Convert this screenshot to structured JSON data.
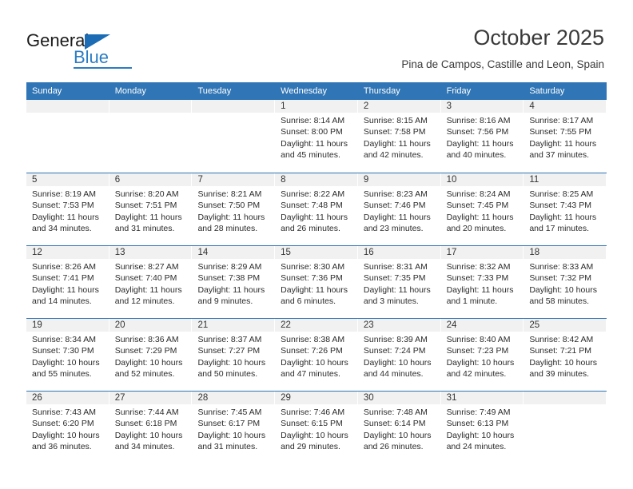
{
  "logo": {
    "word_top": "General",
    "word_bottom": "Blue",
    "accent_color": "#2b7cc4"
  },
  "header": {
    "month_title": "October 2025",
    "location": "Pina de Campos, Castille and Leon, Spain"
  },
  "calendar": {
    "header_bg": "#3075b5",
    "weekdays": [
      "Sunday",
      "Monday",
      "Tuesday",
      "Wednesday",
      "Thursday",
      "Friday",
      "Saturday"
    ],
    "weeks": [
      [
        {
          "day": "",
          "empty": true
        },
        {
          "day": "",
          "empty": true
        },
        {
          "day": "",
          "empty": true
        },
        {
          "day": "1",
          "sunrise": "Sunrise: 8:14 AM",
          "sunset": "Sunset: 8:00 PM",
          "daylight": "Daylight: 11 hours and 45 minutes."
        },
        {
          "day": "2",
          "sunrise": "Sunrise: 8:15 AM",
          "sunset": "Sunset: 7:58 PM",
          "daylight": "Daylight: 11 hours and 42 minutes."
        },
        {
          "day": "3",
          "sunrise": "Sunrise: 8:16 AM",
          "sunset": "Sunset: 7:56 PM",
          "daylight": "Daylight: 11 hours and 40 minutes."
        },
        {
          "day": "4",
          "sunrise": "Sunrise: 8:17 AM",
          "sunset": "Sunset: 7:55 PM",
          "daylight": "Daylight: 11 hours and 37 minutes."
        }
      ],
      [
        {
          "day": "5",
          "sunrise": "Sunrise: 8:19 AM",
          "sunset": "Sunset: 7:53 PM",
          "daylight": "Daylight: 11 hours and 34 minutes."
        },
        {
          "day": "6",
          "sunrise": "Sunrise: 8:20 AM",
          "sunset": "Sunset: 7:51 PM",
          "daylight": "Daylight: 11 hours and 31 minutes."
        },
        {
          "day": "7",
          "sunrise": "Sunrise: 8:21 AM",
          "sunset": "Sunset: 7:50 PM",
          "daylight": "Daylight: 11 hours and 28 minutes."
        },
        {
          "day": "8",
          "sunrise": "Sunrise: 8:22 AM",
          "sunset": "Sunset: 7:48 PM",
          "daylight": "Daylight: 11 hours and 26 minutes."
        },
        {
          "day": "9",
          "sunrise": "Sunrise: 8:23 AM",
          "sunset": "Sunset: 7:46 PM",
          "daylight": "Daylight: 11 hours and 23 minutes."
        },
        {
          "day": "10",
          "sunrise": "Sunrise: 8:24 AM",
          "sunset": "Sunset: 7:45 PM",
          "daylight": "Daylight: 11 hours and 20 minutes."
        },
        {
          "day": "11",
          "sunrise": "Sunrise: 8:25 AM",
          "sunset": "Sunset: 7:43 PM",
          "daylight": "Daylight: 11 hours and 17 minutes."
        }
      ],
      [
        {
          "day": "12",
          "sunrise": "Sunrise: 8:26 AM",
          "sunset": "Sunset: 7:41 PM",
          "daylight": "Daylight: 11 hours and 14 minutes."
        },
        {
          "day": "13",
          "sunrise": "Sunrise: 8:27 AM",
          "sunset": "Sunset: 7:40 PM",
          "daylight": "Daylight: 11 hours and 12 minutes."
        },
        {
          "day": "14",
          "sunrise": "Sunrise: 8:29 AM",
          "sunset": "Sunset: 7:38 PM",
          "daylight": "Daylight: 11 hours and 9 minutes."
        },
        {
          "day": "15",
          "sunrise": "Sunrise: 8:30 AM",
          "sunset": "Sunset: 7:36 PM",
          "daylight": "Daylight: 11 hours and 6 minutes."
        },
        {
          "day": "16",
          "sunrise": "Sunrise: 8:31 AM",
          "sunset": "Sunset: 7:35 PM",
          "daylight": "Daylight: 11 hours and 3 minutes."
        },
        {
          "day": "17",
          "sunrise": "Sunrise: 8:32 AM",
          "sunset": "Sunset: 7:33 PM",
          "daylight": "Daylight: 11 hours and 1 minute."
        },
        {
          "day": "18",
          "sunrise": "Sunrise: 8:33 AM",
          "sunset": "Sunset: 7:32 PM",
          "daylight": "Daylight: 10 hours and 58 minutes."
        }
      ],
      [
        {
          "day": "19",
          "sunrise": "Sunrise: 8:34 AM",
          "sunset": "Sunset: 7:30 PM",
          "daylight": "Daylight: 10 hours and 55 minutes."
        },
        {
          "day": "20",
          "sunrise": "Sunrise: 8:36 AM",
          "sunset": "Sunset: 7:29 PM",
          "daylight": "Daylight: 10 hours and 52 minutes."
        },
        {
          "day": "21",
          "sunrise": "Sunrise: 8:37 AM",
          "sunset": "Sunset: 7:27 PM",
          "daylight": "Daylight: 10 hours and 50 minutes."
        },
        {
          "day": "22",
          "sunrise": "Sunrise: 8:38 AM",
          "sunset": "Sunset: 7:26 PM",
          "daylight": "Daylight: 10 hours and 47 minutes."
        },
        {
          "day": "23",
          "sunrise": "Sunrise: 8:39 AM",
          "sunset": "Sunset: 7:24 PM",
          "daylight": "Daylight: 10 hours and 44 minutes."
        },
        {
          "day": "24",
          "sunrise": "Sunrise: 8:40 AM",
          "sunset": "Sunset: 7:23 PM",
          "daylight": "Daylight: 10 hours and 42 minutes."
        },
        {
          "day": "25",
          "sunrise": "Sunrise: 8:42 AM",
          "sunset": "Sunset: 7:21 PM",
          "daylight": "Daylight: 10 hours and 39 minutes."
        }
      ],
      [
        {
          "day": "26",
          "sunrise": "Sunrise: 7:43 AM",
          "sunset": "Sunset: 6:20 PM",
          "daylight": "Daylight: 10 hours and 36 minutes."
        },
        {
          "day": "27",
          "sunrise": "Sunrise: 7:44 AM",
          "sunset": "Sunset: 6:18 PM",
          "daylight": "Daylight: 10 hours and 34 minutes."
        },
        {
          "day": "28",
          "sunrise": "Sunrise: 7:45 AM",
          "sunset": "Sunset: 6:17 PM",
          "daylight": "Daylight: 10 hours and 31 minutes."
        },
        {
          "day": "29",
          "sunrise": "Sunrise: 7:46 AM",
          "sunset": "Sunset: 6:15 PM",
          "daylight": "Daylight: 10 hours and 29 minutes."
        },
        {
          "day": "30",
          "sunrise": "Sunrise: 7:48 AM",
          "sunset": "Sunset: 6:14 PM",
          "daylight": "Daylight: 10 hours and 26 minutes."
        },
        {
          "day": "31",
          "sunrise": "Sunrise: 7:49 AM",
          "sunset": "Sunset: 6:13 PM",
          "daylight": "Daylight: 10 hours and 24 minutes."
        },
        {
          "day": "",
          "empty": true
        }
      ]
    ]
  }
}
